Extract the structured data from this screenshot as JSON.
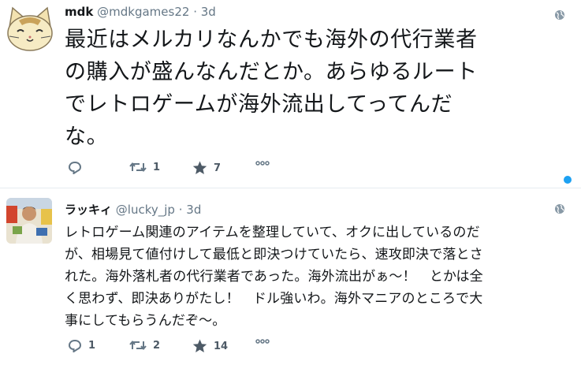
{
  "tweets": [
    {
      "name": "mdk",
      "handle": "@mdkgames22",
      "separator": "·",
      "time": "3d",
      "avatar_icon": "cat-face-avatar",
      "text": "最近はメルカリなんかでも海外の代行業者\nの購入が盛んなんだとか。あらゆるルート\nでレトロゲームが海外流出してってんだ\nな。",
      "reply_count": "",
      "retweet_count": "1",
      "like_count": "7"
    },
    {
      "name": "ラッキィ",
      "handle": "@lucky_jp",
      "separator": "·",
      "time": "3d",
      "avatar_icon": "person-photo-avatar",
      "text": "レトロゲーム関連のアイテムを整理していて、オクに出しているのだ\nが、相場見て値付けして最低と即決つけていたら、速攻即決で落とさ\nれた。海外落札者の代行業者であった。海外流出がぁ～！　とかは全\nく思わず、即決ありがたし！　ドル強いわ。海外マニアのところで大\n事にしてもらうんだぞ～。",
      "reply_count": "1",
      "retweet_count": "2",
      "like_count": "14"
    }
  ],
  "colors": {
    "accent": "#1da1f2",
    "text": "#14171a",
    "secondary": "#657786",
    "divider": "#e6ecf0"
  }
}
